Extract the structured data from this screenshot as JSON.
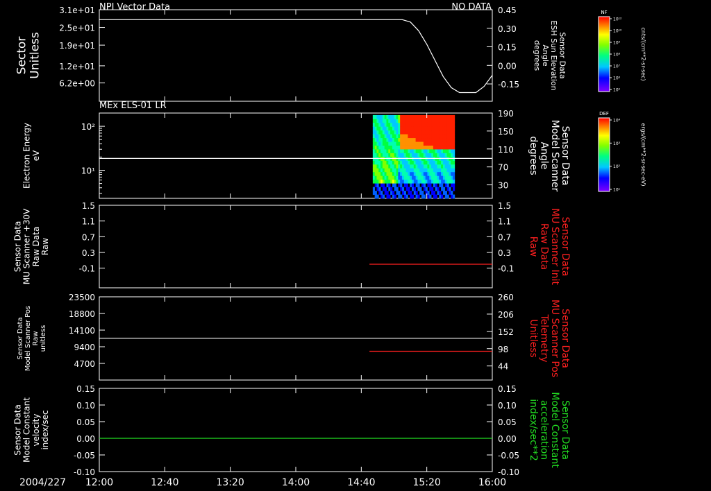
{
  "header": {
    "title": "NPI Vector Data",
    "status": "NO DATA",
    "panel2_title": "MEx ELS-01 LR"
  },
  "time_axis": {
    "date": "2004/227",
    "ticks": [
      "12:00",
      "12:40",
      "13:20",
      "14:00",
      "14:40",
      "15:20",
      "16:00"
    ],
    "tick_minutes": [
      0,
      40,
      80,
      120,
      160,
      200,
      240
    ]
  },
  "colorbars": [
    {
      "label": "NF",
      "unit": "cnts/(cm**2-sr-sec)",
      "ticks": [
        "10¹²",
        "10¹⁰",
        "10⁹",
        "10⁸",
        "10⁷",
        "10⁶",
        "10⁵"
      ]
    },
    {
      "label": "DEF",
      "unit": "ergs/(cm**2-sr-sec-eV)",
      "ticks": [
        "10⁴",
        "10³",
        "10²",
        "10¹"
      ]
    }
  ],
  "colors": {
    "white": "#ffffff",
    "red": "#ff2020",
    "green": "#22dd22",
    "background": "#000000"
  },
  "chart_data": [
    {
      "type": "line",
      "left_axis": {
        "label": [
          "Sector",
          "Unitless"
        ],
        "ticks": [
          "3.1e+01",
          "2.5e+01",
          "1.9e+01",
          "1.2e+01",
          "6.2e+00"
        ],
        "tick_values": [
          31,
          25,
          19,
          12,
          6.2
        ],
        "range": [
          0,
          31
        ]
      },
      "right_axis": {
        "label": [
          "Sensor Data",
          "ESH Sun Elevation",
          "Angle",
          "degrees"
        ],
        "ticks": [
          "0.45",
          "0.30",
          "0.15",
          "0.00",
          "-0.15"
        ],
        "tick_values": [
          0.45,
          0.3,
          0.15,
          0.0,
          -0.15
        ],
        "range": [
          -0.29,
          0.45
        ]
      },
      "series": [
        {
          "axis": "right",
          "color": "white",
          "x_minutes": [
            0,
            185,
            190,
            195,
            200,
            205,
            210,
            215,
            220,
            225,
            230,
            235,
            240
          ],
          "y": [
            0.37,
            0.37,
            0.35,
            0.28,
            0.17,
            0.04,
            -0.09,
            -0.18,
            -0.22,
            -0.22,
            -0.22,
            -0.17,
            -0.08
          ]
        }
      ]
    },
    {
      "type": "heatmap",
      "left_axis": {
        "label": [
          "Electron Energy",
          "eV"
        ],
        "ticks": [
          "10²",
          "10¹"
        ],
        "log": true,
        "range": [
          2.3,
          200
        ]
      },
      "right_axis": {
        "label": [
          "Sensor Data",
          "Model Scanner",
          "Angle",
          "degrees"
        ],
        "ticks": [
          "190",
          "150",
          "110",
          "70",
          "30"
        ],
        "tick_values": [
          190,
          150,
          110,
          70,
          30
        ],
        "range": [
          0,
          190
        ]
      },
      "spectrogram": {
        "x_start_min": 167,
        "x_end_min": 217,
        "energy_min": 2.3,
        "energy_max": 180
      },
      "series": [
        {
          "axis": "right",
          "color": "white",
          "x_minutes": [
            0,
            240
          ],
          "y": [
            89,
            89
          ]
        }
      ]
    },
    {
      "type": "line",
      "left_axis": {
        "label": [
          "Sensor Data",
          "MU Scanner +30V",
          "Raw Data",
          "Raw"
        ],
        "ticks": [
          "1.5",
          "1.1",
          "0.7",
          "0.3",
          "-0.1"
        ],
        "tick_values": [
          1.5,
          1.1,
          0.7,
          0.3,
          -0.1
        ],
        "range": [
          -0.6,
          1.5
        ]
      },
      "right_axis": {
        "label": [
          "Sensor Data",
          "MU Scanner Init",
          "Raw Data",
          "Raw"
        ],
        "label_color": "red",
        "ticks": [
          "1.5",
          "1.1",
          "0.7",
          "0.3",
          "-0.1"
        ],
        "tick_values": [
          1.5,
          1.1,
          0.7,
          0.3,
          -0.1
        ],
        "range": [
          -0.6,
          1.5
        ]
      },
      "series": [
        {
          "axis": "right",
          "color": "red",
          "x_minutes": [
            165,
            240
          ],
          "y": [
            0.0,
            0.0
          ]
        }
      ]
    },
    {
      "type": "line",
      "left_axis": {
        "label": [
          "Sensor Data",
          "Model Scanner Pos",
          "Raw",
          "unitless"
        ],
        "ticks": [
          "23500",
          "18800",
          "14100",
          "9400",
          "4700"
        ],
        "tick_values": [
          23500,
          18800,
          14100,
          9400,
          4700
        ],
        "range": [
          0,
          23500
        ]
      },
      "right_axis": {
        "label": [
          "Sensor Data",
          "MU Scanner Pos",
          "Telemetry",
          "Unitless"
        ],
        "label_color": "red",
        "ticks": [
          "260",
          "206",
          "152",
          "98",
          "44"
        ],
        "tick_values": [
          260,
          206,
          152,
          98,
          44
        ],
        "range": [
          0,
          260
        ]
      },
      "series": [
        {
          "axis": "left",
          "color": "white",
          "x_minutes": [
            0,
            240
          ],
          "y": [
            11800,
            11800
          ]
        },
        {
          "axis": "right",
          "color": "red",
          "x_minutes": [
            165,
            240
          ],
          "y": [
            90,
            90
          ]
        }
      ]
    },
    {
      "type": "line",
      "left_axis": {
        "label": [
          "Sensor Data",
          "Model Constant",
          "velocity",
          "index/sec"
        ],
        "ticks": [
          "0.15",
          "0.10",
          "0.05",
          "0.00",
          "-0.05",
          "-0.10"
        ],
        "tick_values": [
          0.15,
          0.1,
          0.05,
          0.0,
          -0.05,
          -0.1
        ],
        "range": [
          -0.1,
          0.15
        ]
      },
      "right_axis": {
        "label": [
          "Sensor Data",
          "Model Constant",
          "acceleration",
          "index/sec**2"
        ],
        "label_color": "green",
        "ticks": [
          "0.15",
          "0.10",
          "0.05",
          "0.00",
          "-0.05",
          "-0.10"
        ],
        "tick_values": [
          0.15,
          0.1,
          0.05,
          0.0,
          -0.05,
          -0.1
        ],
        "range": [
          -0.1,
          0.15
        ]
      },
      "series": [
        {
          "axis": "left",
          "color": "green",
          "x_minutes": [
            0,
            240
          ],
          "y": [
            0.0,
            0.0
          ]
        }
      ]
    }
  ]
}
